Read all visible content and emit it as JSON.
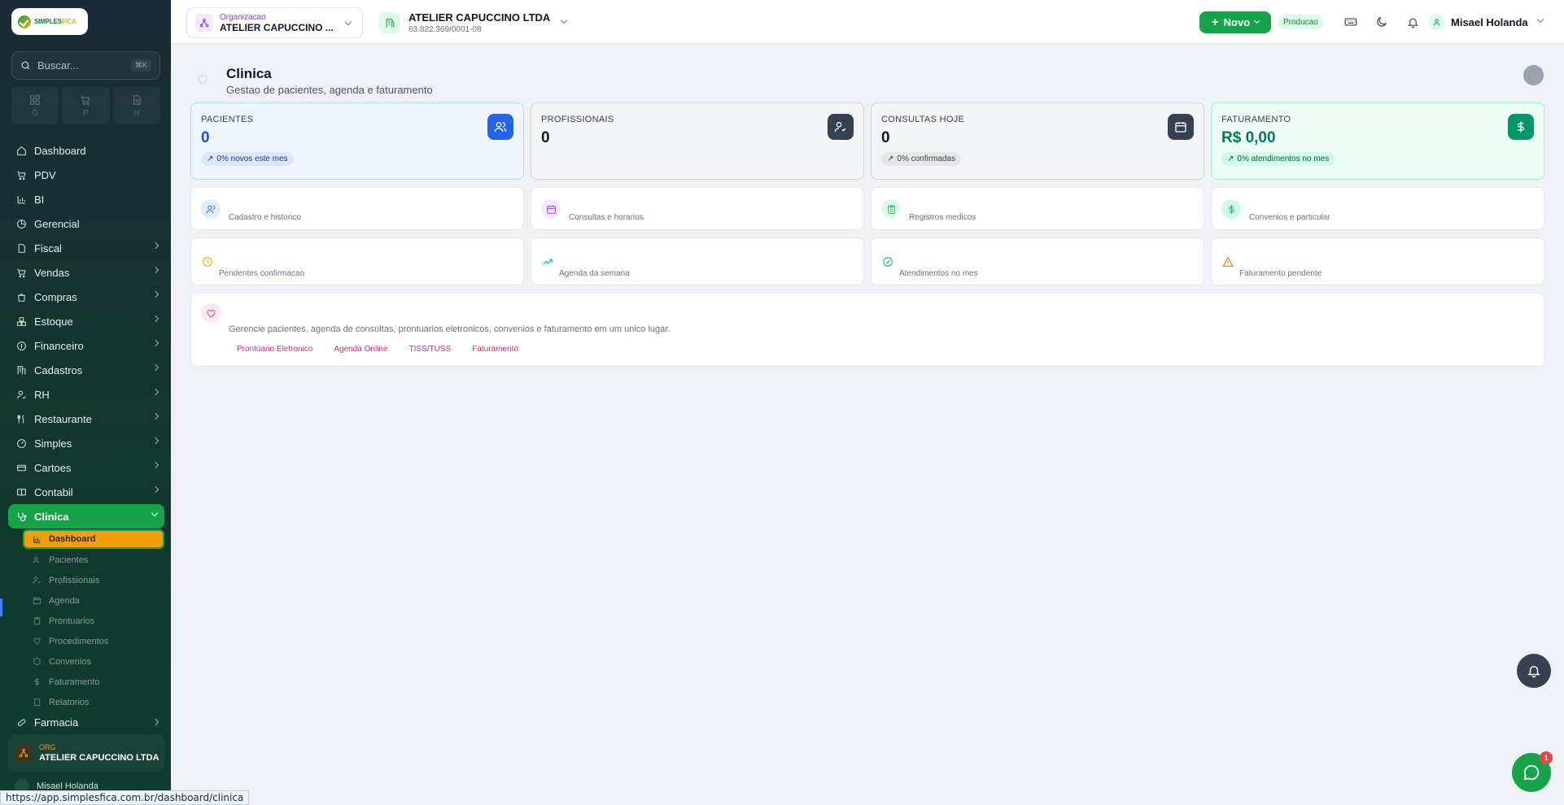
{
  "app": {
    "logo_text_a": "SIMPLES",
    "logo_text_b": "FICA"
  },
  "search": {
    "placeholder": "Buscar...",
    "shortcut": "⌘K"
  },
  "quick": [
    {
      "letter": "G"
    },
    {
      "letter": "P"
    },
    {
      "letter": "N"
    }
  ],
  "nav": [
    {
      "label": "Dashboard",
      "icon": "home-icon"
    },
    {
      "label": "PDV",
      "icon": "cart-icon"
    },
    {
      "label": "BI",
      "icon": "chart-icon"
    },
    {
      "label": "Gerencial",
      "icon": "pie-icon"
    },
    {
      "label": "Fiscal",
      "icon": "file-icon"
    },
    {
      "label": "Vendas",
      "icon": "cart-icon"
    },
    {
      "label": "Compras",
      "icon": "bag-icon"
    },
    {
      "label": "Estoque",
      "icon": "boxes-icon"
    },
    {
      "label": "Financeiro",
      "icon": "wallet-icon"
    },
    {
      "label": "Cadastros",
      "icon": "building-icon"
    },
    {
      "label": "RH",
      "icon": "user-icon"
    },
    {
      "label": "Restaurante",
      "icon": "utensils-icon"
    },
    {
      "label": "Simples",
      "icon": "gauge-icon"
    },
    {
      "label": "Cartoes",
      "icon": "card-icon"
    },
    {
      "label": "Contabil",
      "icon": "book-icon"
    },
    {
      "label": "Clinica",
      "icon": "stethoscope-icon"
    }
  ],
  "clinica_sub": [
    {
      "label": "Dashboard",
      "icon": "chart-icon"
    },
    {
      "label": "Pacientes",
      "icon": "users-icon"
    },
    {
      "label": "Profissionais",
      "icon": "user-check-icon"
    },
    {
      "label": "Agenda",
      "icon": "calendar-icon"
    },
    {
      "label": "Prontuarios",
      "icon": "clipboard-icon"
    },
    {
      "label": "Procedimentos",
      "icon": "heart-pulse-icon"
    },
    {
      "label": "Convenios",
      "icon": "shield-icon"
    },
    {
      "label": "Faturamento",
      "icon": "dollar-icon"
    },
    {
      "label": "Relatorios",
      "icon": "file-icon"
    }
  ],
  "nav_after": {
    "label": "Farmacia"
  },
  "org_box": {
    "label": "ORG",
    "name": "ATELIER CAPUCCINO LTDA"
  },
  "sidebar_user": "Misael Holanda",
  "topbar": {
    "org_label": "Organizacao",
    "org_name": "ATELIER CAPUCCINO ...",
    "company_name": "ATELIER CAPUCCINO LTDA",
    "company_cnpj": "63.822.369/0001-08",
    "novo": "Novo",
    "env_badge": "Producao",
    "user_name": "Misael Holanda"
  },
  "page": {
    "title": "Clinica",
    "subtitle": "Gestao de pacientes, agenda e faturamento"
  },
  "stats": [
    {
      "label": "PACIENTES",
      "value": "0",
      "pill": "0% novos este mes",
      "color": "#2563eb"
    },
    {
      "label": "PROFISSIONAIS",
      "value": "0",
      "pill": "",
      "color": "#374151"
    },
    {
      "label": "CONSULTAS HOJE",
      "value": "0",
      "pill": "0% confirmadas",
      "color": "#374151"
    },
    {
      "label": "FATURAMENTO",
      "value": "R$ 0,00",
      "pill": "0% atendimentos no mes",
      "color": "#059669"
    }
  ],
  "minis": [
    {
      "text": "Cadastro e historico"
    },
    {
      "text": "Consultas e horarios"
    },
    {
      "text": "Registros medicos"
    },
    {
      "text": "Convenios e particular"
    }
  ],
  "minis2": [
    {
      "text": "Pendentes confirmacao"
    },
    {
      "text": "Agenda da semana"
    },
    {
      "text": "Atendimentos no mes"
    },
    {
      "text": "Faturamento pendente"
    }
  ],
  "info": {
    "description": "Gerencie pacientes, agenda de consultas, prontuarios eletronicos, convenios e faturamento em um unico lugar.",
    "links": [
      "Prontuario Eletronico",
      "Agenda Online",
      "TISS/TUSS",
      "Faturamento"
    ]
  },
  "chat_badge": "1",
  "status_url": "https://app.simplesfica.com.br/dashboard/clinica"
}
